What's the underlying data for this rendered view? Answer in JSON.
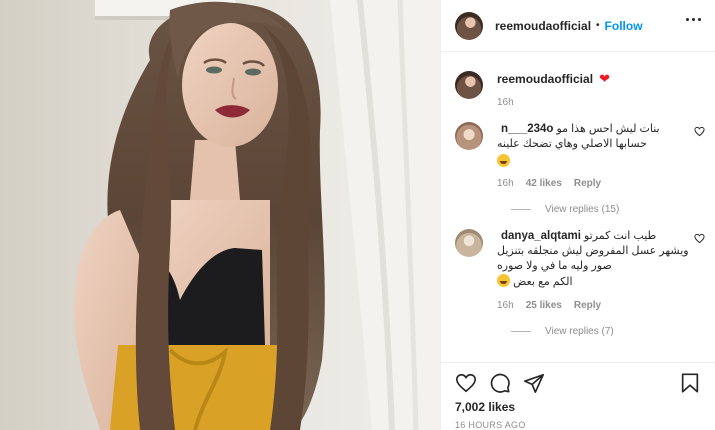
{
  "post": {
    "owner_username": "reemoudaofficial",
    "follow_label": "Follow",
    "separator": "•",
    "caption_emoji": "❤",
    "caption_time": "16h",
    "likes": "7,002 likes",
    "posted_ago": "16 HOURS AGO"
  },
  "comments": [
    {
      "username": "n___234o",
      "text_line1": "بنات ليش احس هذا مو",
      "text_rest": "حسابها الاصلي وهاي تضحك علينه",
      "emoji": "laughing-emoji",
      "time": "16h",
      "likes": "42 likes",
      "reply_label": "Reply",
      "view_replies": "View replies (15)"
    },
    {
      "username": "danya_alqtami",
      "text_line1": "طيب انت كمرتو",
      "text_rest": "ويشهر عسل المفروض ليش منجلقه بتنزيل صور وليه ما في ولا صوره",
      "text_last": "الكم مع بعض",
      "emoji": "laughing-emoji",
      "time": "16h",
      "likes": "25 likes",
      "reply_label": "Reply",
      "view_replies": "View replies (7)"
    }
  ],
  "icons": {
    "more": "more-options-icon",
    "like": "heart-icon",
    "comment": "comment-icon",
    "share": "share-icon",
    "save": "bookmark-icon"
  },
  "colors": {
    "follow_blue": "#0095f6",
    "text": "#262626",
    "muted": "#8e8e8e",
    "heart_red": "#ed1c24",
    "skirt_yellow": "#d9a227",
    "top_black": "#1c1c1e",
    "hair_brown": "#5a4536"
  }
}
